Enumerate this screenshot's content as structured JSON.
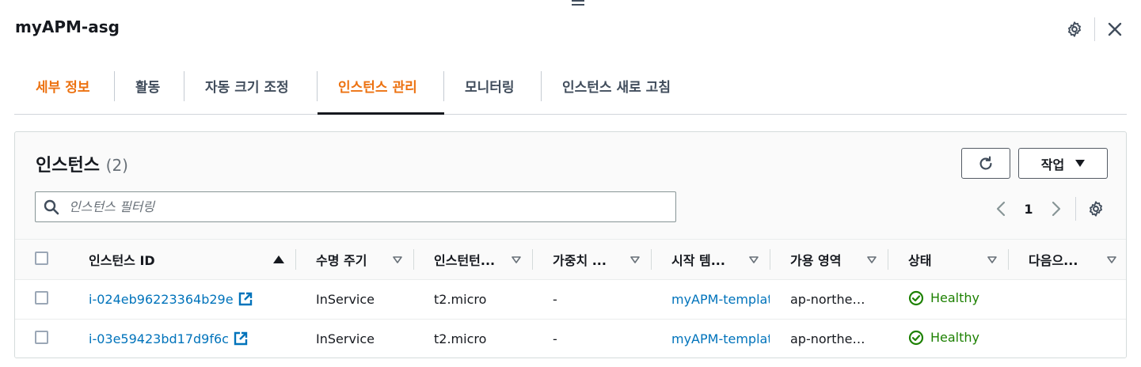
{
  "panel": {
    "title": "myAPM-asg"
  },
  "tabs": [
    {
      "label": "세부 정보"
    },
    {
      "label": "활동"
    },
    {
      "label": "자동 크기 조정"
    },
    {
      "label": "인스턴스 관리"
    },
    {
      "label": "모니터링"
    },
    {
      "label": "인스턴스 새로 고침"
    }
  ],
  "instances": {
    "title": "인스턴스",
    "count": "(2)",
    "actions_label": "작업",
    "search_placeholder": "인스턴스 필터링",
    "page": "1",
    "columns": [
      {
        "label": "인스턴스 ID"
      },
      {
        "label": "수명 주기"
      },
      {
        "label": "인스턴턴..."
      },
      {
        "label": "가중치 ..."
      },
      {
        "label": "시작 템..."
      },
      {
        "label": "가용 영역"
      },
      {
        "label": "상태"
      },
      {
        "label": "다음으..."
      }
    ],
    "rows": [
      {
        "id": "i-024eb96223364b29e",
        "lifecycle": "InService",
        "type": "t2.micro",
        "weight": "-",
        "template": "myAPM-templat",
        "az": "ap-northe…",
        "status": "Healthy",
        "next": ""
      },
      {
        "id": "i-03e59423bd17d9f6c",
        "lifecycle": "InService",
        "type": "t2.micro",
        "weight": "-",
        "template": "myAPM-templat",
        "az": "ap-northe…",
        "status": "Healthy",
        "next": ""
      }
    ]
  },
  "colors": {
    "accent": "#ec7211",
    "link": "#0073bb",
    "healthy": "#1d8102"
  }
}
